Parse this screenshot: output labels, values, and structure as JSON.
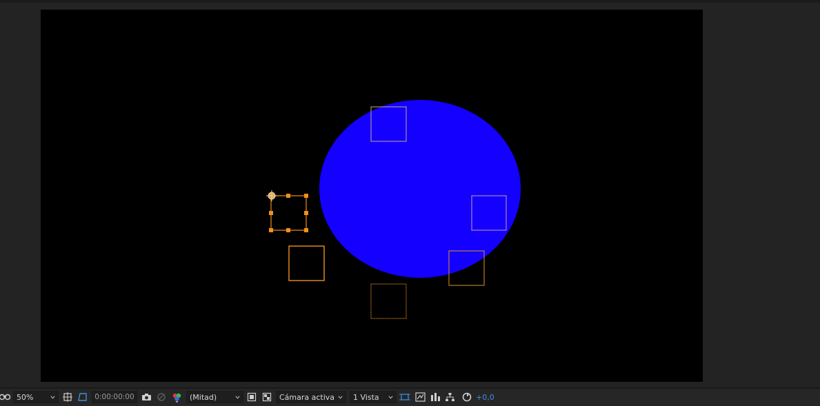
{
  "toolbar": {
    "zoom": "50%",
    "timecode": "0:00:00:00",
    "resolution": "(Mitad)",
    "camera": "Cámara activa",
    "views": "1 Vista",
    "exposure": "+0,0"
  },
  "icons": [
    "magnifier-glasses-icon",
    "region-of-interest-icon",
    "transparency-grid-toggle-icon",
    "snapshot-camera-icon",
    "show-snapshot-icon",
    "color-channels-icon",
    "fast-previews-icon",
    "checkerboard-icon",
    "3d-view-icon",
    "preview-options-icon",
    "flowchart-icon",
    "reset-exposure-icon"
  ],
  "colors": {
    "ellipse": "#1400ff",
    "selection": "#f0901c",
    "accent": "#3d8fe0",
    "canvas": "#000000"
  }
}
